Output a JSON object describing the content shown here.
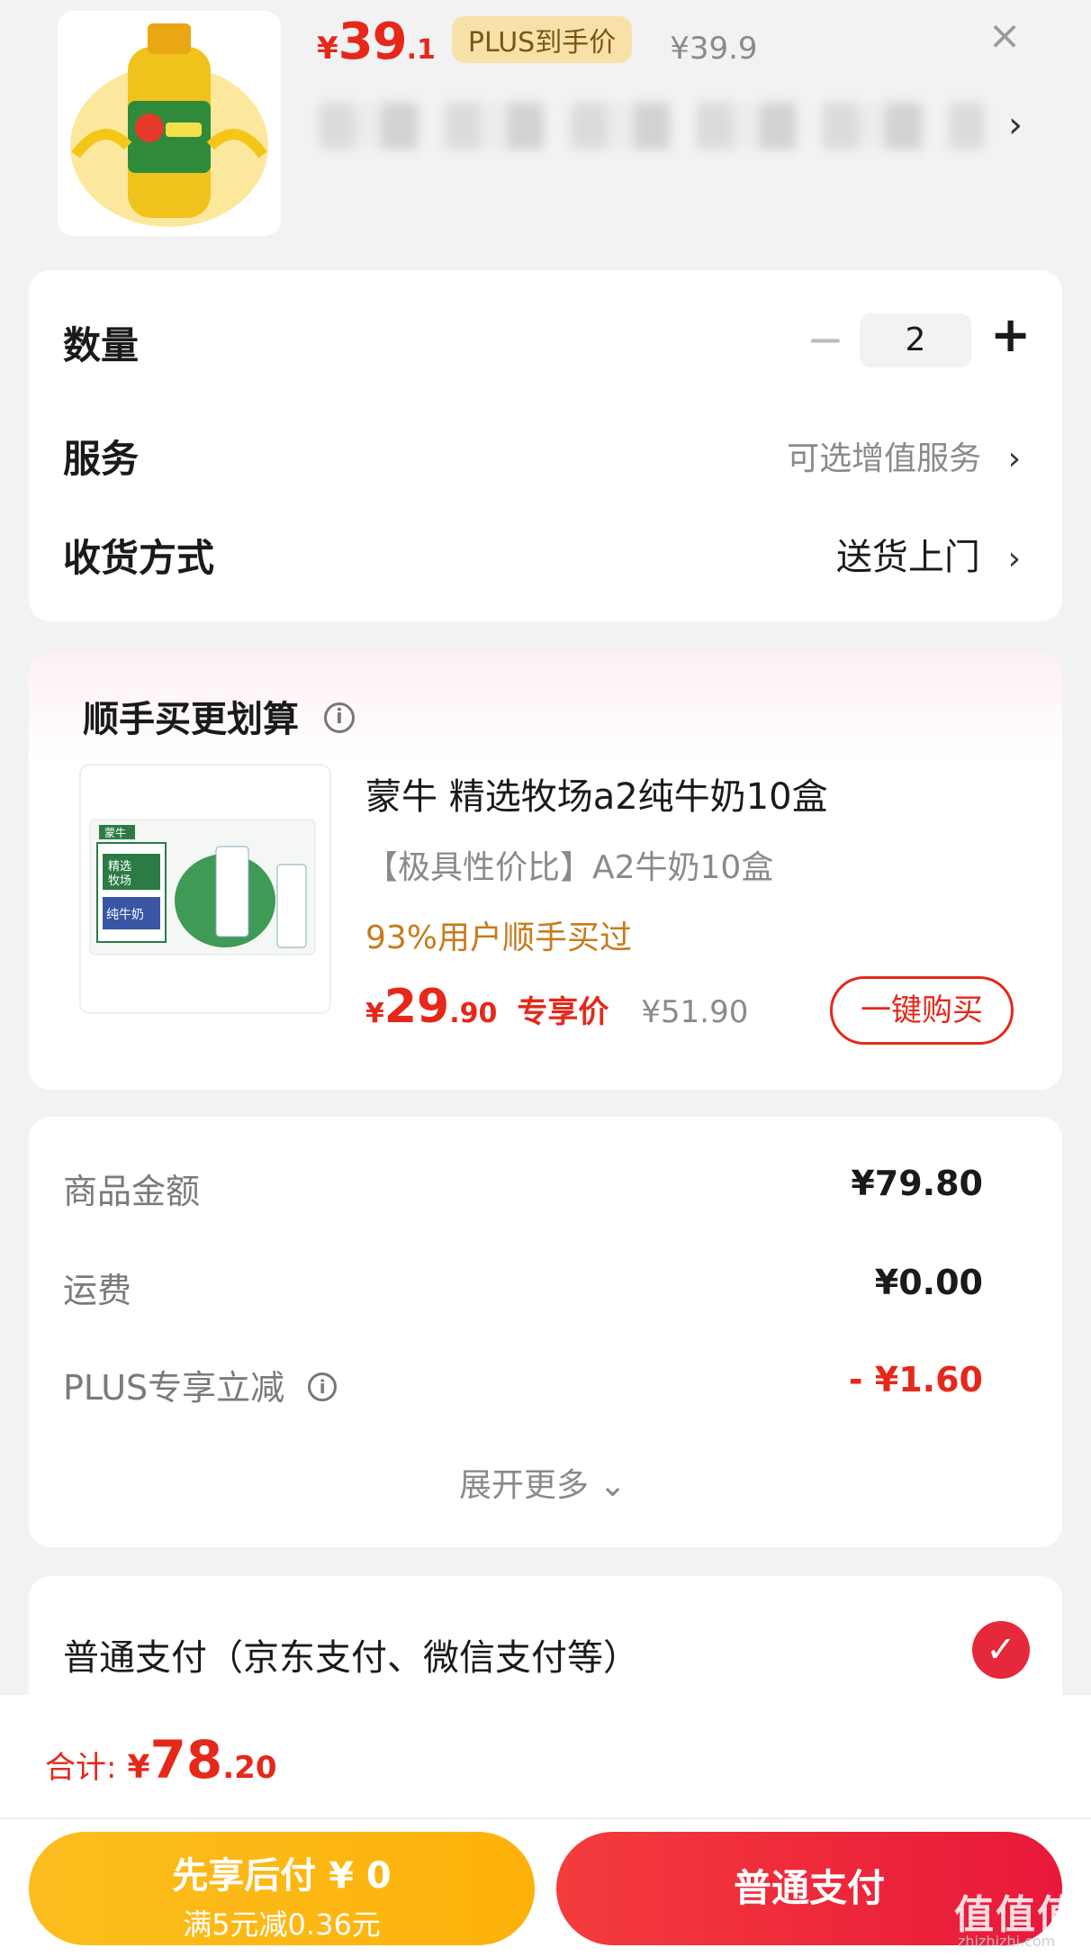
{
  "product": {
    "price_symbol": "¥",
    "price_int": "39",
    "price_dec": ".1",
    "plus_tag": "PLUS到手价",
    "original_price": "¥39.9",
    "close_icon": "×",
    "title_chevron": "›"
  },
  "options": {
    "quantity_label": "数量",
    "quantity_minus": "−",
    "quantity_value": "2",
    "quantity_plus": "+",
    "service_label": "服务",
    "service_value": "可选增值服务",
    "shipping_label": "收货方式",
    "shipping_value": "送货上门",
    "chevron": "›"
  },
  "bundle": {
    "title": "顺手买更划算",
    "info_icon": "i",
    "item_name": "蒙牛 精选牧场a2纯牛奶10盒",
    "item_desc": "【极具性价比】A2牛奶10盒",
    "item_social": "93%用户顺手买过",
    "price_symbol": "¥",
    "price_int": "29",
    "price_dec": ".90",
    "price_tag": "专享价",
    "original_price": "¥51.90",
    "buy_button": "一键购买",
    "thumb_brand": "蒙牛",
    "thumb_line1": "精选",
    "thumb_line2": "牧场",
    "thumb_line3": "纯牛奶"
  },
  "amounts": {
    "goods_label": "商品金额",
    "goods_value": "¥79.80",
    "freight_label": "运费",
    "freight_value": "¥0.00",
    "plus_label": "PLUS专享立减",
    "plus_value": "- ¥1.60",
    "expand": "展开更多 ⌄"
  },
  "payment": {
    "method_label": "普通支付（京东支付、微信支付等）",
    "check_icon": "✓"
  },
  "footer": {
    "total_label": "合计:",
    "total_symbol": "¥",
    "total_int": "78",
    "total_dec": ".20",
    "later_main": "先享后付 ¥ 0",
    "later_sub": "满5元减0.36元",
    "pay_button": "普通支付",
    "watermark": "值值值",
    "watermark_sub": "zhizhizhi.com"
  },
  "colors": {
    "accent_red": "#e5281a",
    "gold": "#fdb20a",
    "plus_tag_bg": "#f8e1a9"
  }
}
